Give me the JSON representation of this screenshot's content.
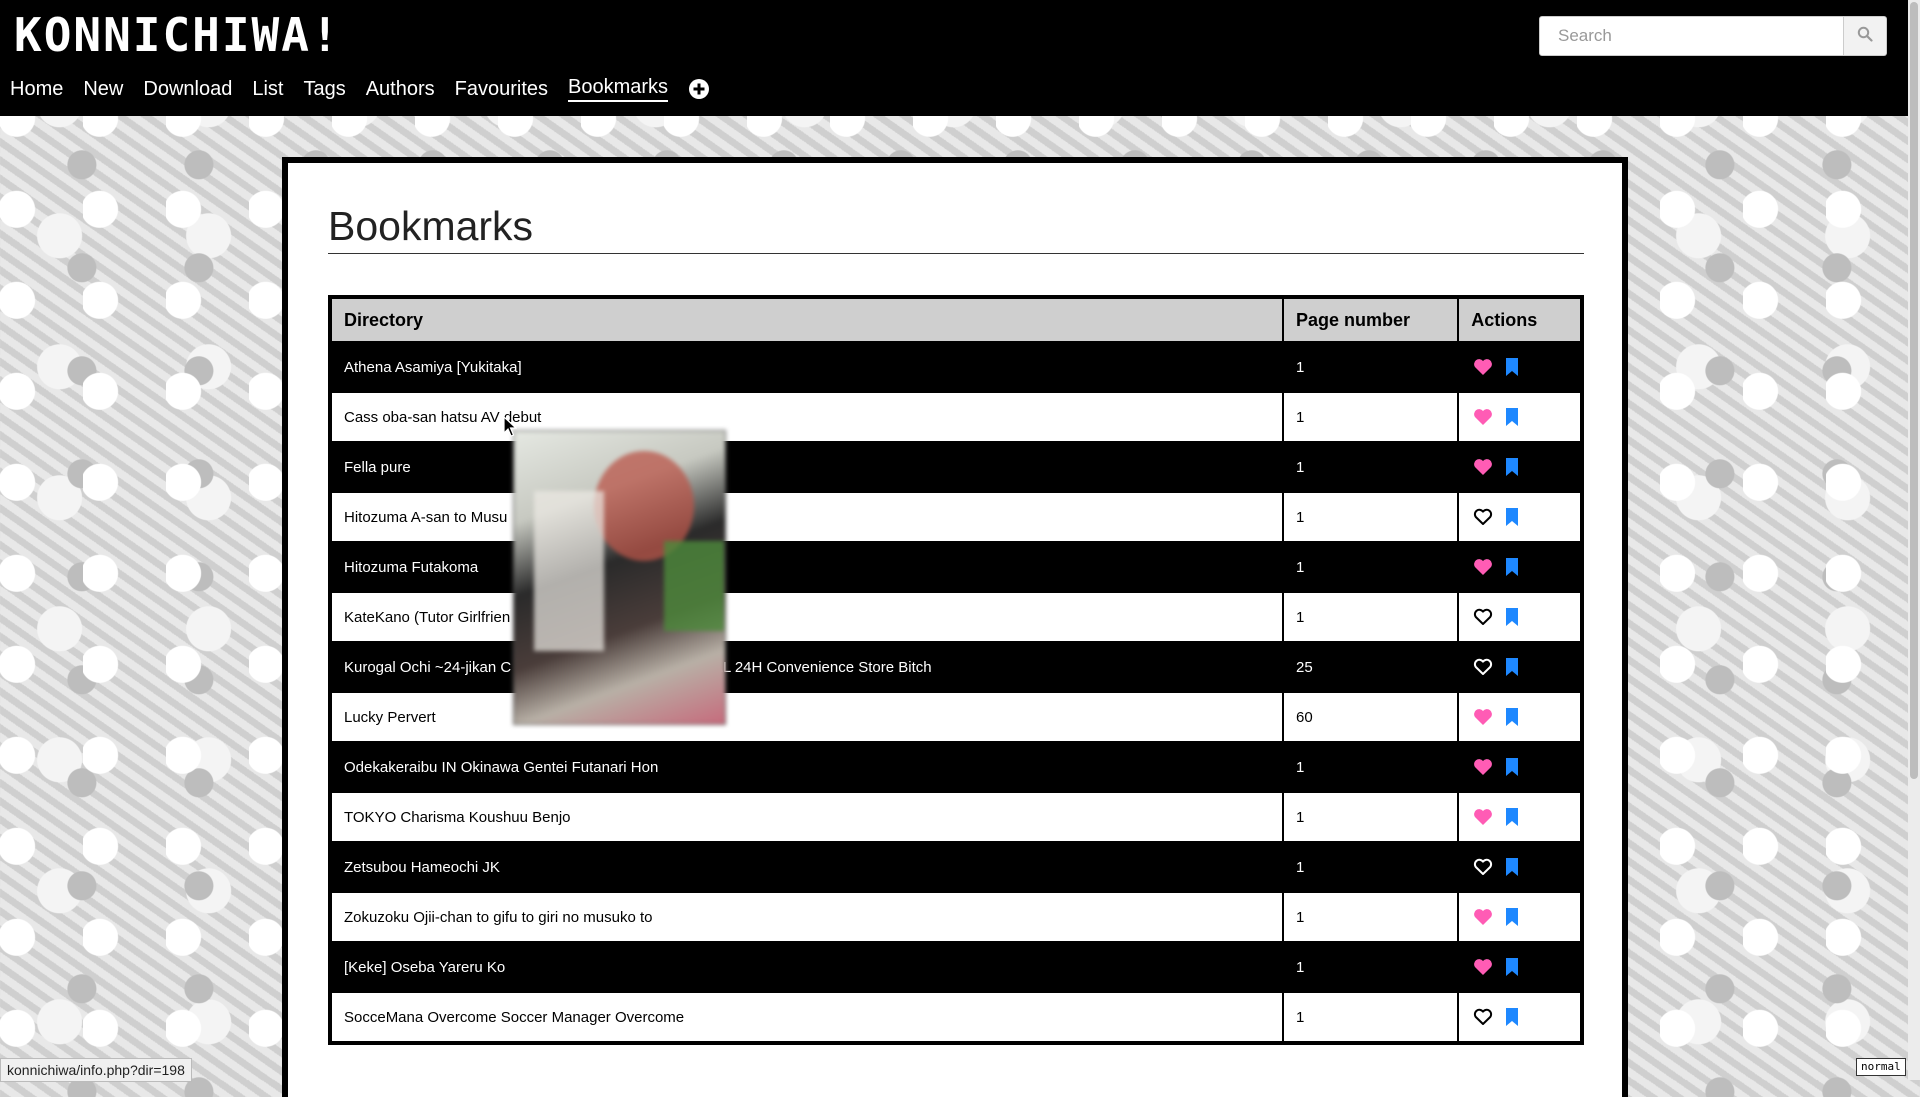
{
  "header": {
    "logo": "KONNICHIWA!",
    "search_placeholder": "Search"
  },
  "nav": {
    "items": [
      "Home",
      "New",
      "Download",
      "List",
      "Tags",
      "Authors",
      "Favourites",
      "Bookmarks"
    ],
    "active": "Bookmarks",
    "add_icon": "plus-circle-icon"
  },
  "page": {
    "title": "Bookmarks"
  },
  "table": {
    "headers": [
      "Directory",
      "Page number",
      "Actions"
    ],
    "rows": [
      {
        "directory": "Athena Asamiya [Yukitaka]",
        "page": "1",
        "favourite": true
      },
      {
        "directory": "Cass oba-san hatsu AV debut",
        "page": "1",
        "favourite": true
      },
      {
        "directory": "Fella pure",
        "page": "1",
        "favourite": true
      },
      {
        "directory": "Hitozuma A-san to Musu",
        "page": "1",
        "favourite": false
      },
      {
        "directory": "Hitozuma Futakoma",
        "page": "1",
        "favourite": true
      },
      {
        "directory": "KateKano (Tutor Girlfrien",
        "page": "1",
        "favourite": false
      },
      {
        "directory": "Kurogal Ochi ~24-jikan C                                    IMMORAL 24H Convenience Store Bitch",
        "page": "25",
        "favourite": false
      },
      {
        "directory": "Lucky Pervert",
        "page": "60",
        "favourite": true
      },
      {
        "directory": "Odekakeraibu IN Okinawa Gentei Futanari Hon",
        "page": "1",
        "favourite": true
      },
      {
        "directory": "TOKYO Charisma Koushuu Benjo",
        "page": "1",
        "favourite": true
      },
      {
        "directory": "Zetsubou Hameochi JK",
        "page": "1",
        "favourite": false
      },
      {
        "directory": "Zokuzoku Ojii-chan to gifu to giri no musuko to",
        "page": "1",
        "favourite": true
      },
      {
        "directory": "[Keke] Oseba Yareru Ko",
        "page": "1",
        "favourite": true
      },
      {
        "directory": "SocceMana Overcome Soccer Manager Overcome",
        "page": "1",
        "favourite": false
      }
    ]
  },
  "colors": {
    "favourite_filled": "#ff5cb5",
    "bookmark": "#1e88ff",
    "header_bg": "#000000"
  },
  "statusbar": {
    "url": "konnichiwa/info.php?dir=198"
  },
  "mode_badge": "normal"
}
